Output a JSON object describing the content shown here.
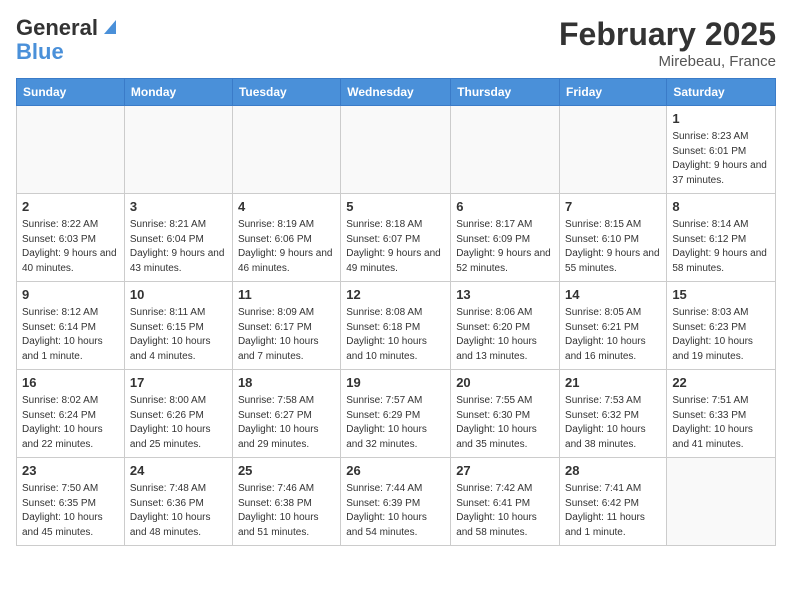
{
  "logo": {
    "line1": "General",
    "line2": "Blue"
  },
  "title": "February 2025",
  "location": "Mirebeau, France",
  "weekdays": [
    "Sunday",
    "Monday",
    "Tuesday",
    "Wednesday",
    "Thursday",
    "Friday",
    "Saturday"
  ],
  "weeks": [
    [
      {
        "day": "",
        "text": ""
      },
      {
        "day": "",
        "text": ""
      },
      {
        "day": "",
        "text": ""
      },
      {
        "day": "",
        "text": ""
      },
      {
        "day": "",
        "text": ""
      },
      {
        "day": "",
        "text": ""
      },
      {
        "day": "1",
        "text": "Sunrise: 8:23 AM\nSunset: 6:01 PM\nDaylight: 9 hours and 37 minutes."
      }
    ],
    [
      {
        "day": "2",
        "text": "Sunrise: 8:22 AM\nSunset: 6:03 PM\nDaylight: 9 hours and 40 minutes."
      },
      {
        "day": "3",
        "text": "Sunrise: 8:21 AM\nSunset: 6:04 PM\nDaylight: 9 hours and 43 minutes."
      },
      {
        "day": "4",
        "text": "Sunrise: 8:19 AM\nSunset: 6:06 PM\nDaylight: 9 hours and 46 minutes."
      },
      {
        "day": "5",
        "text": "Sunrise: 8:18 AM\nSunset: 6:07 PM\nDaylight: 9 hours and 49 minutes."
      },
      {
        "day": "6",
        "text": "Sunrise: 8:17 AM\nSunset: 6:09 PM\nDaylight: 9 hours and 52 minutes."
      },
      {
        "day": "7",
        "text": "Sunrise: 8:15 AM\nSunset: 6:10 PM\nDaylight: 9 hours and 55 minutes."
      },
      {
        "day": "8",
        "text": "Sunrise: 8:14 AM\nSunset: 6:12 PM\nDaylight: 9 hours and 58 minutes."
      }
    ],
    [
      {
        "day": "9",
        "text": "Sunrise: 8:12 AM\nSunset: 6:14 PM\nDaylight: 10 hours and 1 minute."
      },
      {
        "day": "10",
        "text": "Sunrise: 8:11 AM\nSunset: 6:15 PM\nDaylight: 10 hours and 4 minutes."
      },
      {
        "day": "11",
        "text": "Sunrise: 8:09 AM\nSunset: 6:17 PM\nDaylight: 10 hours and 7 minutes."
      },
      {
        "day": "12",
        "text": "Sunrise: 8:08 AM\nSunset: 6:18 PM\nDaylight: 10 hours and 10 minutes."
      },
      {
        "day": "13",
        "text": "Sunrise: 8:06 AM\nSunset: 6:20 PM\nDaylight: 10 hours and 13 minutes."
      },
      {
        "day": "14",
        "text": "Sunrise: 8:05 AM\nSunset: 6:21 PM\nDaylight: 10 hours and 16 minutes."
      },
      {
        "day": "15",
        "text": "Sunrise: 8:03 AM\nSunset: 6:23 PM\nDaylight: 10 hours and 19 minutes."
      }
    ],
    [
      {
        "day": "16",
        "text": "Sunrise: 8:02 AM\nSunset: 6:24 PM\nDaylight: 10 hours and 22 minutes."
      },
      {
        "day": "17",
        "text": "Sunrise: 8:00 AM\nSunset: 6:26 PM\nDaylight: 10 hours and 25 minutes."
      },
      {
        "day": "18",
        "text": "Sunrise: 7:58 AM\nSunset: 6:27 PM\nDaylight: 10 hours and 29 minutes."
      },
      {
        "day": "19",
        "text": "Sunrise: 7:57 AM\nSunset: 6:29 PM\nDaylight: 10 hours and 32 minutes."
      },
      {
        "day": "20",
        "text": "Sunrise: 7:55 AM\nSunset: 6:30 PM\nDaylight: 10 hours and 35 minutes."
      },
      {
        "day": "21",
        "text": "Sunrise: 7:53 AM\nSunset: 6:32 PM\nDaylight: 10 hours and 38 minutes."
      },
      {
        "day": "22",
        "text": "Sunrise: 7:51 AM\nSunset: 6:33 PM\nDaylight: 10 hours and 41 minutes."
      }
    ],
    [
      {
        "day": "23",
        "text": "Sunrise: 7:50 AM\nSunset: 6:35 PM\nDaylight: 10 hours and 45 minutes."
      },
      {
        "day": "24",
        "text": "Sunrise: 7:48 AM\nSunset: 6:36 PM\nDaylight: 10 hours and 48 minutes."
      },
      {
        "day": "25",
        "text": "Sunrise: 7:46 AM\nSunset: 6:38 PM\nDaylight: 10 hours and 51 minutes."
      },
      {
        "day": "26",
        "text": "Sunrise: 7:44 AM\nSunset: 6:39 PM\nDaylight: 10 hours and 54 minutes."
      },
      {
        "day": "27",
        "text": "Sunrise: 7:42 AM\nSunset: 6:41 PM\nDaylight: 10 hours and 58 minutes."
      },
      {
        "day": "28",
        "text": "Sunrise: 7:41 AM\nSunset: 6:42 PM\nDaylight: 11 hours and 1 minute."
      },
      {
        "day": "",
        "text": ""
      }
    ]
  ]
}
